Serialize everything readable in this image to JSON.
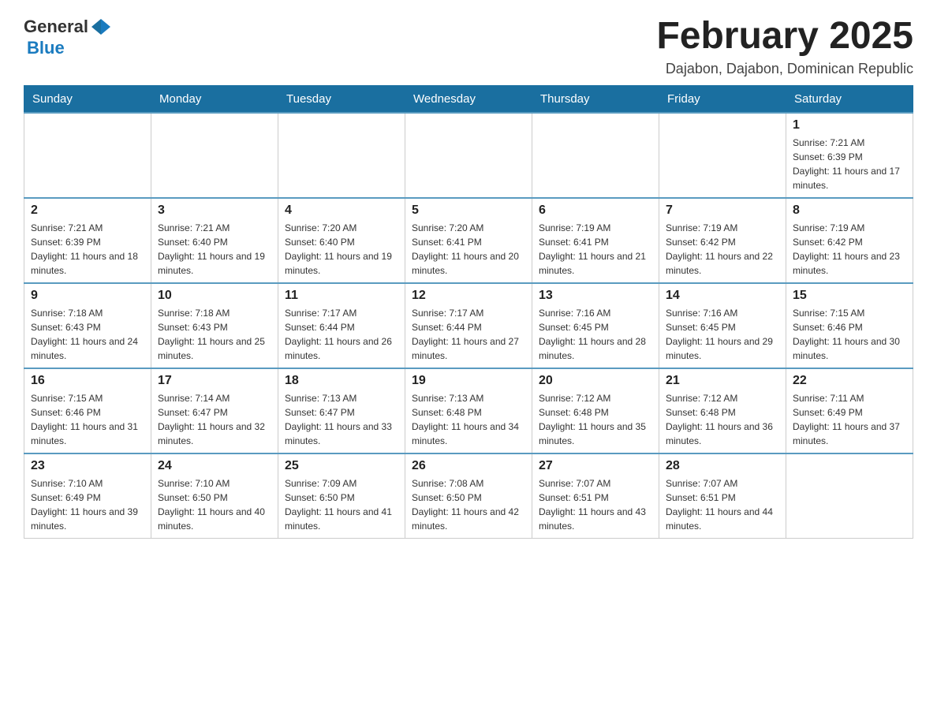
{
  "header": {
    "logo_general": "General",
    "logo_blue": "Blue",
    "month_title": "February 2025",
    "location": "Dajabon, Dajabon, Dominican Republic"
  },
  "weekdays": [
    "Sunday",
    "Monday",
    "Tuesday",
    "Wednesday",
    "Thursday",
    "Friday",
    "Saturday"
  ],
  "weeks": [
    [
      {
        "day": "",
        "sunrise": "",
        "sunset": "",
        "daylight": ""
      },
      {
        "day": "",
        "sunrise": "",
        "sunset": "",
        "daylight": ""
      },
      {
        "day": "",
        "sunrise": "",
        "sunset": "",
        "daylight": ""
      },
      {
        "day": "",
        "sunrise": "",
        "sunset": "",
        "daylight": ""
      },
      {
        "day": "",
        "sunrise": "",
        "sunset": "",
        "daylight": ""
      },
      {
        "day": "",
        "sunrise": "",
        "sunset": "",
        "daylight": ""
      },
      {
        "day": "1",
        "sunrise": "Sunrise: 7:21 AM",
        "sunset": "Sunset: 6:39 PM",
        "daylight": "Daylight: 11 hours and 17 minutes."
      }
    ],
    [
      {
        "day": "2",
        "sunrise": "Sunrise: 7:21 AM",
        "sunset": "Sunset: 6:39 PM",
        "daylight": "Daylight: 11 hours and 18 minutes."
      },
      {
        "day": "3",
        "sunrise": "Sunrise: 7:21 AM",
        "sunset": "Sunset: 6:40 PM",
        "daylight": "Daylight: 11 hours and 19 minutes."
      },
      {
        "day": "4",
        "sunrise": "Sunrise: 7:20 AM",
        "sunset": "Sunset: 6:40 PM",
        "daylight": "Daylight: 11 hours and 19 minutes."
      },
      {
        "day": "5",
        "sunrise": "Sunrise: 7:20 AM",
        "sunset": "Sunset: 6:41 PM",
        "daylight": "Daylight: 11 hours and 20 minutes."
      },
      {
        "day": "6",
        "sunrise": "Sunrise: 7:19 AM",
        "sunset": "Sunset: 6:41 PM",
        "daylight": "Daylight: 11 hours and 21 minutes."
      },
      {
        "day": "7",
        "sunrise": "Sunrise: 7:19 AM",
        "sunset": "Sunset: 6:42 PM",
        "daylight": "Daylight: 11 hours and 22 minutes."
      },
      {
        "day": "8",
        "sunrise": "Sunrise: 7:19 AM",
        "sunset": "Sunset: 6:42 PM",
        "daylight": "Daylight: 11 hours and 23 minutes."
      }
    ],
    [
      {
        "day": "9",
        "sunrise": "Sunrise: 7:18 AM",
        "sunset": "Sunset: 6:43 PM",
        "daylight": "Daylight: 11 hours and 24 minutes."
      },
      {
        "day": "10",
        "sunrise": "Sunrise: 7:18 AM",
        "sunset": "Sunset: 6:43 PM",
        "daylight": "Daylight: 11 hours and 25 minutes."
      },
      {
        "day": "11",
        "sunrise": "Sunrise: 7:17 AM",
        "sunset": "Sunset: 6:44 PM",
        "daylight": "Daylight: 11 hours and 26 minutes."
      },
      {
        "day": "12",
        "sunrise": "Sunrise: 7:17 AM",
        "sunset": "Sunset: 6:44 PM",
        "daylight": "Daylight: 11 hours and 27 minutes."
      },
      {
        "day": "13",
        "sunrise": "Sunrise: 7:16 AM",
        "sunset": "Sunset: 6:45 PM",
        "daylight": "Daylight: 11 hours and 28 minutes."
      },
      {
        "day": "14",
        "sunrise": "Sunrise: 7:16 AM",
        "sunset": "Sunset: 6:45 PM",
        "daylight": "Daylight: 11 hours and 29 minutes."
      },
      {
        "day": "15",
        "sunrise": "Sunrise: 7:15 AM",
        "sunset": "Sunset: 6:46 PM",
        "daylight": "Daylight: 11 hours and 30 minutes."
      }
    ],
    [
      {
        "day": "16",
        "sunrise": "Sunrise: 7:15 AM",
        "sunset": "Sunset: 6:46 PM",
        "daylight": "Daylight: 11 hours and 31 minutes."
      },
      {
        "day": "17",
        "sunrise": "Sunrise: 7:14 AM",
        "sunset": "Sunset: 6:47 PM",
        "daylight": "Daylight: 11 hours and 32 minutes."
      },
      {
        "day": "18",
        "sunrise": "Sunrise: 7:13 AM",
        "sunset": "Sunset: 6:47 PM",
        "daylight": "Daylight: 11 hours and 33 minutes."
      },
      {
        "day": "19",
        "sunrise": "Sunrise: 7:13 AM",
        "sunset": "Sunset: 6:48 PM",
        "daylight": "Daylight: 11 hours and 34 minutes."
      },
      {
        "day": "20",
        "sunrise": "Sunrise: 7:12 AM",
        "sunset": "Sunset: 6:48 PM",
        "daylight": "Daylight: 11 hours and 35 minutes."
      },
      {
        "day": "21",
        "sunrise": "Sunrise: 7:12 AM",
        "sunset": "Sunset: 6:48 PM",
        "daylight": "Daylight: 11 hours and 36 minutes."
      },
      {
        "day": "22",
        "sunrise": "Sunrise: 7:11 AM",
        "sunset": "Sunset: 6:49 PM",
        "daylight": "Daylight: 11 hours and 37 minutes."
      }
    ],
    [
      {
        "day": "23",
        "sunrise": "Sunrise: 7:10 AM",
        "sunset": "Sunset: 6:49 PM",
        "daylight": "Daylight: 11 hours and 39 minutes."
      },
      {
        "day": "24",
        "sunrise": "Sunrise: 7:10 AM",
        "sunset": "Sunset: 6:50 PM",
        "daylight": "Daylight: 11 hours and 40 minutes."
      },
      {
        "day": "25",
        "sunrise": "Sunrise: 7:09 AM",
        "sunset": "Sunset: 6:50 PM",
        "daylight": "Daylight: 11 hours and 41 minutes."
      },
      {
        "day": "26",
        "sunrise": "Sunrise: 7:08 AM",
        "sunset": "Sunset: 6:50 PM",
        "daylight": "Daylight: 11 hours and 42 minutes."
      },
      {
        "day": "27",
        "sunrise": "Sunrise: 7:07 AM",
        "sunset": "Sunset: 6:51 PM",
        "daylight": "Daylight: 11 hours and 43 minutes."
      },
      {
        "day": "28",
        "sunrise": "Sunrise: 7:07 AM",
        "sunset": "Sunset: 6:51 PM",
        "daylight": "Daylight: 11 hours and 44 minutes."
      },
      {
        "day": "",
        "sunrise": "",
        "sunset": "",
        "daylight": ""
      }
    ]
  ]
}
